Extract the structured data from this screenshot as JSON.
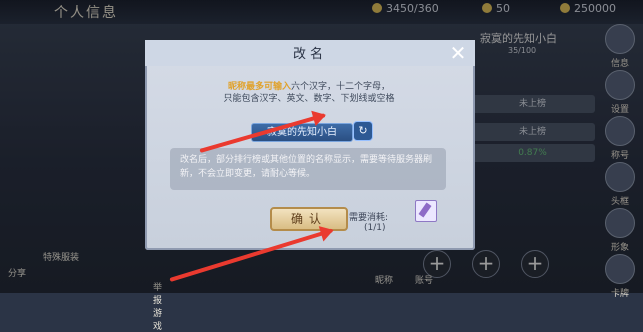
{
  "topbar": {
    "title": "个人信息",
    "resources": [
      "3450/360",
      "50",
      "250000"
    ]
  },
  "right_menu": [
    "信息",
    "设置",
    "称号",
    "头框",
    "形象",
    "卡牌"
  ],
  "right_panel": {
    "name_line": "寂寞的先知小白",
    "exp": "35/100",
    "rows": [
      "未上榜",
      "未上榜",
      "0.87%"
    ],
    "labels": [
      "昵称",
      "账号"
    ]
  },
  "bottom_left": [
    "分享",
    "特殊服装",
    "举报游戏"
  ],
  "modal": {
    "title": "改名",
    "close": "✕",
    "rule_1": "昵称最多可输入",
    "rule_2": "六个汉字，十二个字母，",
    "rule_3": "只能包含汉字、英文、数字、下划线或空格",
    "name_value": "寂寞的先知小白",
    "dice": "↻",
    "description": "改名后，部分排行榜或其他位置的名称显示，需要等待服务器刷新，不会立即变更，请耐心等候。",
    "confirm": "确认",
    "cost_label": "需要消耗:",
    "cost_count": "(1/1)"
  }
}
